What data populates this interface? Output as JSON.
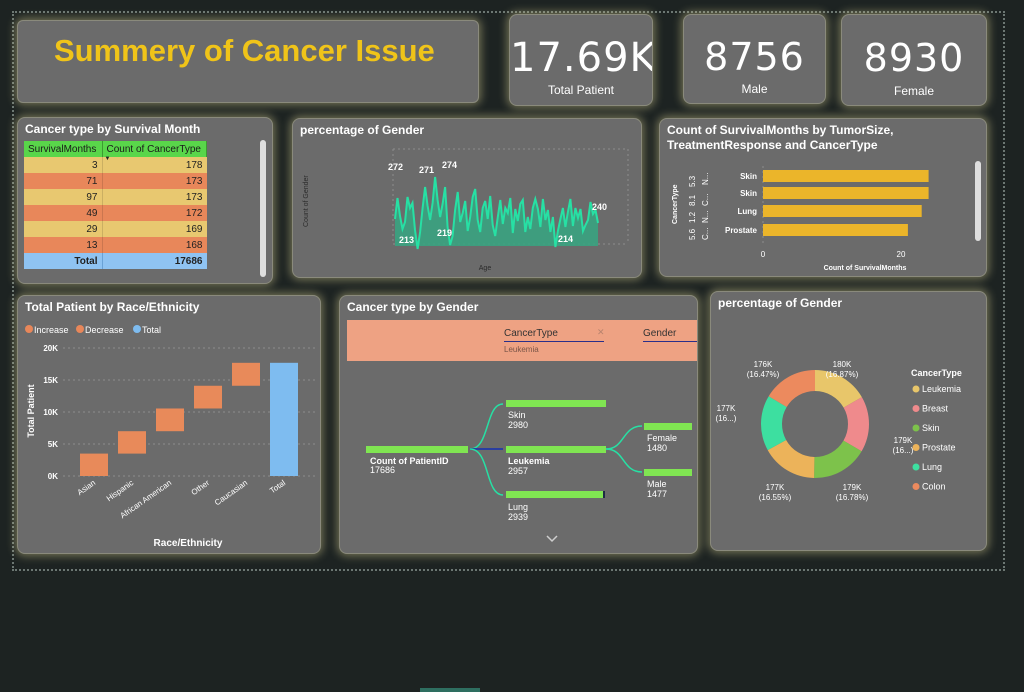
{
  "colors": {
    "accent_gold": "#f0c419",
    "teal": "#27e0a4",
    "orange": "#e88a5a",
    "blue": "#7ebcf0",
    "bar_gold": "#ebb52a",
    "green": "#80e552"
  },
  "header": {
    "title": "Summery of Cancer Issue"
  },
  "kpis": [
    {
      "value": "17.69K",
      "label": "Total Patient"
    },
    {
      "value": "8756",
      "label": "Male"
    },
    {
      "value": "8930",
      "label": "Female"
    }
  ],
  "survival_table": {
    "title": "Cancer type by Survival Month",
    "columns": [
      "SurvivalMonths",
      "Count of CancerType"
    ],
    "sort_icon": "sort-down-icon",
    "rows": [
      {
        "months": "3",
        "count": "178",
        "color": "#e8c870"
      },
      {
        "months": "71",
        "count": "173",
        "color": "#e8875a"
      },
      {
        "months": "97",
        "count": "173",
        "color": "#e8c870"
      },
      {
        "months": "49",
        "count": "172",
        "color": "#e8875a"
      },
      {
        "months": "29",
        "count": "169",
        "color": "#e8c870"
      },
      {
        "months": "13",
        "count": "168",
        "color": "#e8875a"
      }
    ],
    "total_label": "Total",
    "total_value": "17686"
  },
  "gender_area": {
    "title": "percentage of Gender",
    "ylabel": "Count of Gender",
    "xlabel": "Age",
    "labels": [
      "272",
      "271",
      "274",
      "213",
      "219",
      "214",
      "240"
    ]
  },
  "tumor_chart": {
    "title_line1": "Count of SurvivalMonths by TumorSize,",
    "title_line2": "TreatmentResponse and CancerType",
    "ylabel": "CancerType",
    "xlabel": "Count of SurvivalMonths",
    "group_labels": [
      "5.6",
      "1.2",
      "8.1",
      "5.3",
      "C...",
      "N...",
      "C...",
      "N..."
    ],
    "ticks": [
      "0",
      "20"
    ],
    "bars": [
      {
        "label": "Skin",
        "value": 24
      },
      {
        "label": "Skin",
        "value": 24
      },
      {
        "label": "Lung",
        "value": 23
      },
      {
        "label": "Prostate",
        "value": 21
      }
    ]
  },
  "chart_data": [
    {
      "type": "bar",
      "chart_subtype": "waterfall",
      "title": "Total Patient by Race/Ethnicity",
      "xlabel": "Race/Ethnicity",
      "ylabel": "Total Patient",
      "legend": [
        "Increase",
        "Decrease",
        "Total"
      ],
      "yticks": [
        "20K",
        "15K",
        "10K",
        "5K",
        "0K"
      ],
      "ylim": [
        0,
        20000
      ],
      "categories": [
        "Asian",
        "Hispanic",
        "African American",
        "Other",
        "Caucasian",
        "Total"
      ],
      "values": [
        3500,
        3500,
        3550,
        3550,
        3586,
        17686
      ],
      "kinds": [
        "increase",
        "increase",
        "increase",
        "increase",
        "increase",
        "total"
      ]
    },
    {
      "type": "pie",
      "chart_subtype": "donut",
      "title": "percentage of Gender",
      "legend_title": "CancerType",
      "series": [
        {
          "name": "Leukemia",
          "value": 2957,
          "label": "180K",
          "pct": "(16.87%)",
          "color": "#e8c66a"
        },
        {
          "name": "Breast",
          "value": 2954,
          "label": "179K",
          "pct": "(16...)",
          "color": "#ef8a8c"
        },
        {
          "name": "Skin",
          "value": 2980,
          "label": "179K",
          "pct": "(16.78%)",
          "color": "#7dc24b"
        },
        {
          "name": "Prostate",
          "value": 2954,
          "label": "177K",
          "pct": "(16.55%)",
          "color": "#ecb35a"
        },
        {
          "name": "Lung",
          "value": 2939,
          "label": "177K",
          "pct": "(16...)",
          "color": "#3ddfa0"
        },
        {
          "name": "Colon",
          "value": 2902,
          "label": "176K",
          "pct": "(16.47%)",
          "color": "#ec8a5e"
        }
      ]
    }
  ],
  "gender_tree": {
    "title": "Cancer type by Gender",
    "filter_col1": "CancerType",
    "filter_col2": "Gender",
    "filter_value": "Leukemia",
    "root_label": "Count of PatientID",
    "root_value": "17686",
    "level1": [
      {
        "label": "Skin",
        "value": "2980"
      },
      {
        "label": "Leukemia",
        "value": "2957"
      },
      {
        "label": "Lung",
        "value": "2939"
      }
    ],
    "level2": [
      {
        "label": "Female",
        "value": "1480"
      },
      {
        "label": "Male",
        "value": "1477"
      }
    ]
  }
}
